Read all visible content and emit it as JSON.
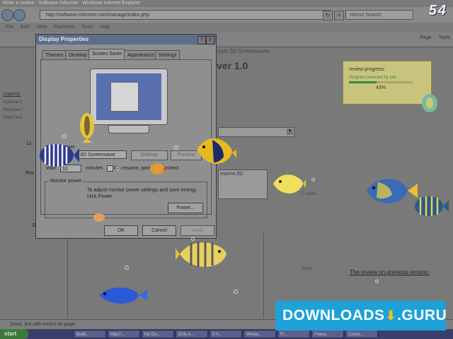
{
  "browser": {
    "title": "Write a review - Software Informer - Windows Internet Explorer",
    "url": "http://software.informer.com/manage/index.php",
    "search_placeholder": "Yahoo! Search",
    "fps_counter": "54",
    "menu": [
      "File",
      "Edit",
      "View",
      "Favorites",
      "Tools",
      "Help"
    ],
    "toolbar_right": [
      "Page",
      "Tools"
    ]
  },
  "page": {
    "subtitle": "arium 3D Screensaver",
    "title": "ver 1.0",
    "legend_label": "Legend:",
    "legend_items": [
      "Optional fi",
      "Required f",
      "Filled field"
    ],
    "review_progress": {
      "title": "review progress:",
      "subtitle": "Program reserved by you",
      "percent": "43%",
      "fraction": 0.43
    },
    "keywords_value": "marine,3D",
    "chars_right": "77 chars",
    "chars_left": "chars",
    "review_link": "The review on previous version:",
    "left_labels": [
      "Li",
      "Pro",
      "D"
    ]
  },
  "dialog": {
    "title": "Display Properties",
    "help": "?",
    "close": "X",
    "tabs": [
      "Themes",
      "Desktop",
      "Screen Saver",
      "Appearance",
      "Settings"
    ],
    "active_tab": "Screen Saver",
    "screensaver_group_label": "Screen saver",
    "screensaver_selected": "3D Screensaver",
    "settings_label": "Settings",
    "preview_label": "Preview",
    "wait_label": "Wait:",
    "wait_value": "10",
    "minutes_label": "minutes",
    "resume_label": "On resume, password protect",
    "power_group_label": "Monitor power",
    "power_desc": "To adjust monitor power settings and save energy, click Power.",
    "power_button": "Power...",
    "ok": "OK",
    "cancel": "Cancel",
    "apply": "Apply"
  },
  "status": {
    "text": "Done, but with errors on page."
  },
  "taskbar": {
    "start": "start",
    "items": [
      "Build...",
      "http://...",
      "My Do...",
      "Enfy A...",
      "3 V...",
      "Windo...",
      "Fr...",
      "Freew...",
      "Comp..."
    ]
  },
  "watermark": {
    "text": "DOWNLOADS",
    "suffix": ".GURU"
  },
  "colors": {
    "watermark_bg": "#1da1d8",
    "taskbar_bg": "#3a3e6a",
    "dialog_title_bg": "#5d6e8a",
    "review_box_bg": "#c9c47d"
  }
}
